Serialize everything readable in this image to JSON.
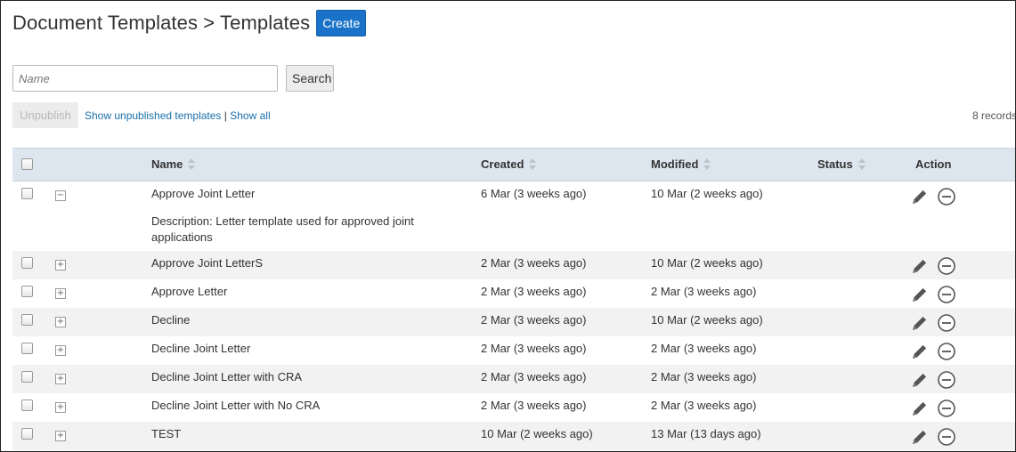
{
  "header": {
    "title": "Document Templates > Templates",
    "create_label": "Create"
  },
  "search": {
    "placeholder": "Name",
    "value": "",
    "button_label": "Search"
  },
  "toolbar": {
    "unpublish_label": "Unpublish",
    "show_unpublished": "Show unpublished templates",
    "separator": "|",
    "show_all": "Show all",
    "records": "8 records"
  },
  "table": {
    "columns": {
      "name": "Name",
      "created": "Created",
      "modified": "Modified",
      "status": "Status",
      "action": "Action"
    },
    "rows": [
      {
        "name": "Approve Joint Letter",
        "created": "6 Mar (3 weeks ago)",
        "modified": "10 Mar (2 weeks ago)",
        "status": "",
        "expanded": true,
        "description": "Description: Letter template used for approved joint applications"
      },
      {
        "name": "Approve Joint LetterS",
        "created": "2 Mar (3 weeks ago)",
        "modified": "10 Mar (2 weeks ago)",
        "status": "",
        "expanded": false
      },
      {
        "name": "Approve Letter",
        "created": "2 Mar (3 weeks ago)",
        "modified": "2 Mar (3 weeks ago)",
        "status": "",
        "expanded": false
      },
      {
        "name": "Decline",
        "created": "2 Mar (3 weeks ago)",
        "modified": "10 Mar (2 weeks ago)",
        "status": "",
        "expanded": false
      },
      {
        "name": "Decline Joint Letter",
        "created": "2 Mar (3 weeks ago)",
        "modified": "2 Mar (3 weeks ago)",
        "status": "",
        "expanded": false
      },
      {
        "name": "Decline Joint Letter with CRA",
        "created": "2 Mar (3 weeks ago)",
        "modified": "2 Mar (3 weeks ago)",
        "status": "",
        "expanded": false
      },
      {
        "name": "Decline Joint Letter with No CRA",
        "created": "2 Mar (3 weeks ago)",
        "modified": "2 Mar (3 weeks ago)",
        "status": "",
        "expanded": false
      },
      {
        "name": "TEST",
        "created": "10 Mar (2 weeks ago)",
        "modified": "13 Mar (13 days ago)",
        "status": "",
        "expanded": false
      }
    ]
  },
  "icons": {
    "edit": "pencil-icon",
    "remove": "minus-circle-icon",
    "expand": "plus-square-icon",
    "collapse": "minus-square-icon"
  },
  "colors": {
    "accent": "#1a73c9",
    "link": "#1a6fa8",
    "header_bg": "#dde6ee",
    "alt_row": "#f2f2f2"
  }
}
